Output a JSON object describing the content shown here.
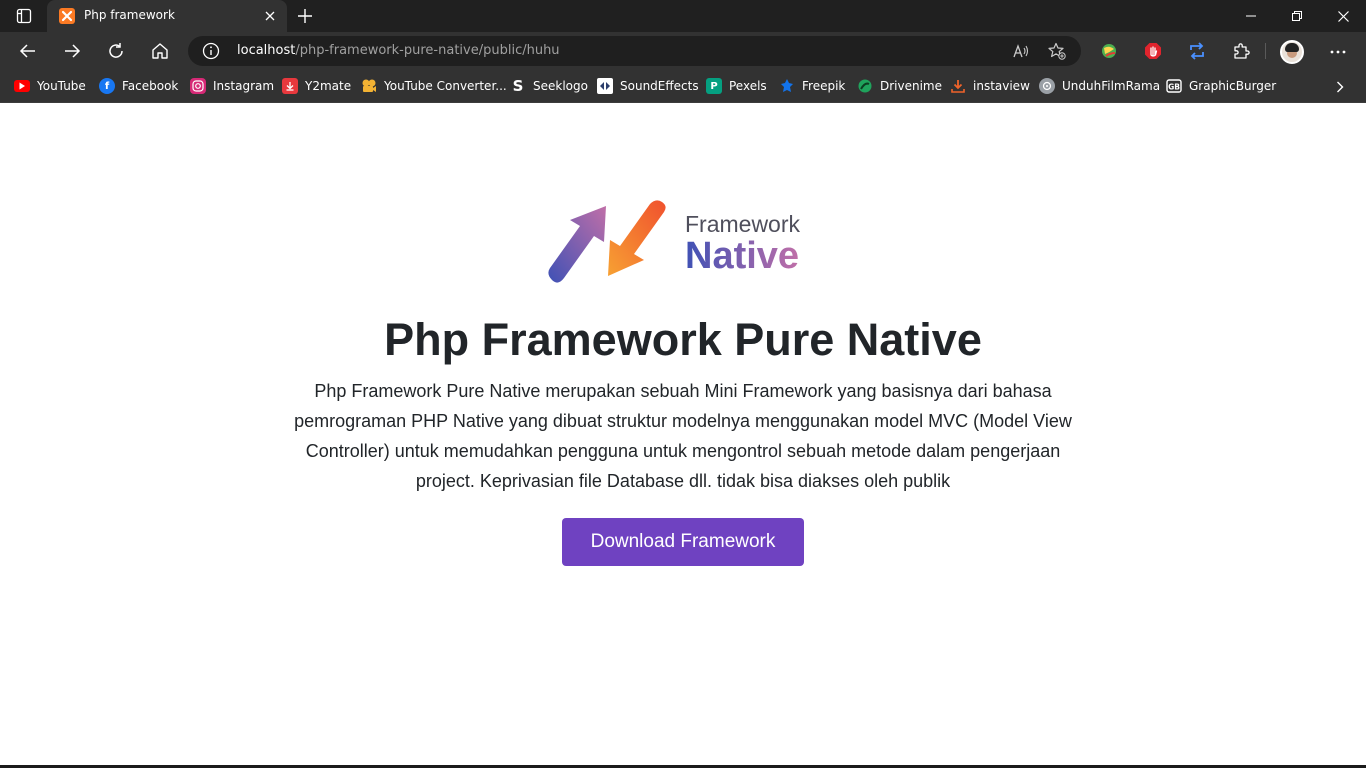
{
  "browser": {
    "tab": {
      "title": "Php framework",
      "favicon": "xampp-icon"
    },
    "address": {
      "host": "localhost",
      "path": "/php-framework-pure-native/public/huhu"
    },
    "colors": {
      "titlebar": "#202020",
      "toolbar": "#323232",
      "address_bg": "#1f1f1f"
    }
  },
  "bookmarks": [
    {
      "label": "YouTube",
      "icon": "youtube-icon",
      "color": "#ff0000"
    },
    {
      "label": "Facebook",
      "icon": "facebook-icon",
      "color": "#1877f2"
    },
    {
      "label": "Instagram",
      "icon": "instagram-icon",
      "color": "#d62976"
    },
    {
      "label": "Y2mate",
      "icon": "y2mate-icon",
      "color": "#e8383d"
    },
    {
      "label": "YouTube Converter...",
      "icon": "converter-icon",
      "color": "#f2b233"
    },
    {
      "label": "Seeklogo",
      "icon": "seeklogo-icon",
      "color": "#ffffff"
    },
    {
      "label": "SoundEffects",
      "icon": "soundeffects-icon",
      "color": "#ffffff"
    },
    {
      "label": "Pexels",
      "icon": "pexels-icon",
      "color": "#05a081"
    },
    {
      "label": "Freepik",
      "icon": "freepik-icon",
      "color": "#1273eb"
    },
    {
      "label": "Drivenime",
      "icon": "drivenime-icon",
      "color": "#1fa35c"
    },
    {
      "label": "instaview",
      "icon": "instaview-icon",
      "color": "#f0632a"
    },
    {
      "label": "UnduhFilmRama",
      "icon": "unduhfilmrama-icon",
      "color": "#9aa0a6"
    },
    {
      "label": "GraphicBurger",
      "icon": "graphicburger-icon",
      "color": "#ffffff"
    }
  ],
  "page": {
    "logo": {
      "top": "Framework",
      "bottom": "Native"
    },
    "title": "Php Framework Pure Native",
    "description": "Php Framework Pure Native merupakan sebuah Mini Framework yang basisnya dari bahasa pemrograman PHP Native yang dibuat struktur modelnya menggunakan model MVC (Model View Controller) untuk memudahkan pengguna untuk mengontrol sebuah metode dalam pengerjaan project. Keprivasian file Database dll. tidak bisa diakses oleh publik",
    "button_label": "Download Framework",
    "colors": {
      "accent": "#6f42c1",
      "text": "#212529",
      "logo_gradient_start": "#3f51b5",
      "logo_gradient_end": "#c06fa8"
    }
  }
}
